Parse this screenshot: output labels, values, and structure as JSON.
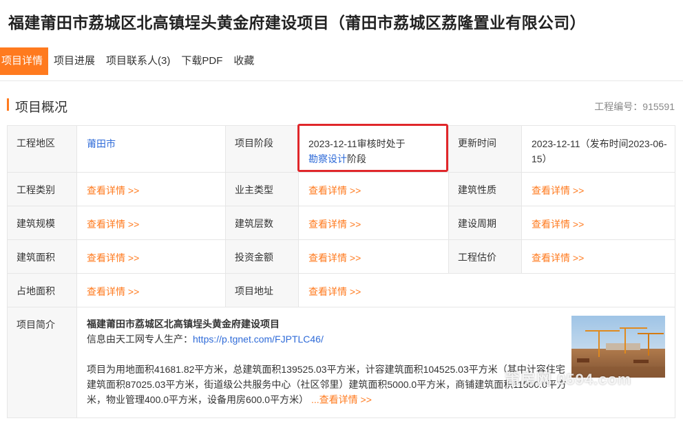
{
  "page": {
    "title": "福建莆田市荔城区北高镇埕头黄金府建设项目（莆田市荔城区荔隆置业有限公司）"
  },
  "tabs": [
    {
      "label": "项目详情"
    },
    {
      "label": "项目进展"
    },
    {
      "label": "项目联系人(3)"
    },
    {
      "label": "下载PDF"
    },
    {
      "label": "收藏"
    }
  ],
  "section": {
    "title": "项目概况",
    "project_no_label": "工程编号：",
    "project_no": "915591"
  },
  "rows": {
    "r1": {
      "l1": "工程地区",
      "v1": "莆田市",
      "l2": "项目阶段",
      "v2_prefix": "2023-12-11审核时处于",
      "v2_link": "勘察设计",
      "v2_suffix": "阶段",
      "l3": "更新时间",
      "v3": "2023-12-11（发布时间2023-06-15）"
    },
    "r2": {
      "l1": "工程类别",
      "l2": "业主类型",
      "l3": "建筑性质"
    },
    "r3": {
      "l1": "建筑规模",
      "l2": "建筑层数",
      "l3": "建设周期"
    },
    "r4": {
      "l1": "建筑面积",
      "l2": "投资金额",
      "l3": "工程估价"
    },
    "r5": {
      "l1": "占地面积",
      "l2": "项目地址"
    },
    "view_detail": "查看详情 >>"
  },
  "intro": {
    "label": "项目简介",
    "name": "福建莆田市荔城区北高镇埕头黄金府建设项目",
    "source_prefix": "信息由天工网专人生产：",
    "source_url": "https://p.tgnet.com/FJPTLC46/",
    "body": "项目为用地面积41681.82平方米，总建筑面积139525.03平方米，计容建筑面积104525.03平方米（其中计容住宅建筑面积87025.03平方米，街道级公共服务中心（社区邻里）建筑面积5000.0平方米，商铺建筑面积11500.0平方米，物业管理400.0平方米，设备用房600.0平方米）",
    "more": "...查看详情 >>"
  },
  "watermark": "莆房网 0594.com",
  "colors": {
    "accent": "#ff7a1e",
    "link": "#2f6bd8",
    "highlight": "#e0262a"
  }
}
